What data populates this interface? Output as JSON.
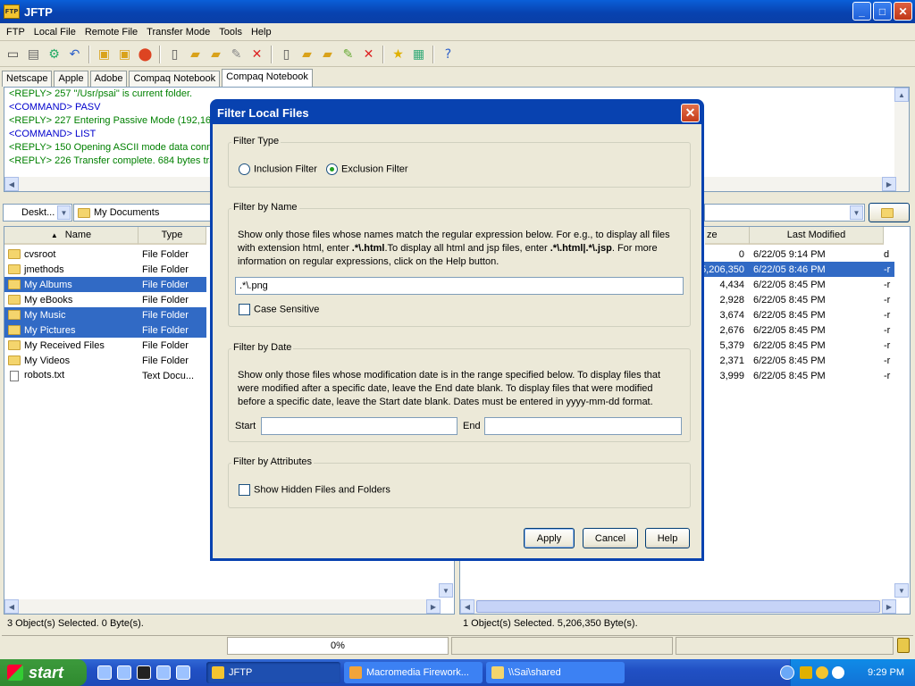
{
  "window": {
    "title": "JFTP",
    "icon_label": "FTP",
    "minimize": "_",
    "maximize": "□",
    "close": "✕"
  },
  "menu": [
    "FTP",
    "Local File",
    "Remote File",
    "Transfer Mode",
    "Tools",
    "Help"
  ],
  "tabs": [
    "Netscape",
    "Apple",
    "Adobe",
    "Compaq Notebook",
    "Compaq Notebook"
  ],
  "log": [
    {
      "text": "<REPLY> 257 \"/Usr/psai\" is current folder.",
      "color": "#008000"
    },
    {
      "text": "<COMMAND> PASV",
      "color": "#0000cc"
    },
    {
      "text": "<REPLY> 227 Entering Passive Mode (192,168",
      "color": "#008000"
    },
    {
      "text": "<COMMAND> LIST",
      "color": "#0000cc"
    },
    {
      "text": "<REPLY> 150 Opening ASCII mode data conne",
      "color": "#008000"
    },
    {
      "text": "<REPLY> 226 Transfer complete. 684 bytes tra",
      "color": "#008000"
    }
  ],
  "local": {
    "drive": "Deskt...",
    "path": "My Documents",
    "columns": [
      "Name",
      "Type"
    ],
    "rows": [
      {
        "name": "cvsroot",
        "type": "File Folder",
        "selected": false,
        "icon": "folder"
      },
      {
        "name": "jmethods",
        "type": "File Folder",
        "selected": false,
        "icon": "folder"
      },
      {
        "name": "My Albums",
        "type": "File Folder",
        "selected": true,
        "icon": "folder"
      },
      {
        "name": "My eBooks",
        "type": "File Folder",
        "selected": false,
        "icon": "folder"
      },
      {
        "name": "My Music",
        "type": "File Folder",
        "selected": true,
        "icon": "folder"
      },
      {
        "name": "My Pictures",
        "type": "File Folder",
        "selected": true,
        "icon": "folder"
      },
      {
        "name": "My Received Files",
        "type": "File Folder",
        "selected": false,
        "icon": "folder"
      },
      {
        "name": "My Videos",
        "type": "File Folder",
        "selected": false,
        "icon": "folder"
      },
      {
        "name": "robots.txt",
        "type": "Text Docu...",
        "selected": false,
        "icon": "file"
      }
    ],
    "status": "3 Object(s) Selected. 0 Byte(s)."
  },
  "remote": {
    "columns": [
      "ze",
      "Last Modified"
    ],
    "rows": [
      {
        "size": "0",
        "modified": "6/22/05 9:14 PM",
        "attr": "d",
        "selected": false
      },
      {
        "size": "5,206,350",
        "modified": "6/22/05 8:46 PM",
        "attr": "-r",
        "selected": true
      },
      {
        "size": "4,434",
        "modified": "6/22/05 8:45 PM",
        "attr": "-r",
        "selected": false
      },
      {
        "size": "2,928",
        "modified": "6/22/05 8:45 PM",
        "attr": "-r",
        "selected": false
      },
      {
        "size": "3,674",
        "modified": "6/22/05 8:45 PM",
        "attr": "-r",
        "selected": false
      },
      {
        "size": "2,676",
        "modified": "6/22/05 8:45 PM",
        "attr": "-r",
        "selected": false
      },
      {
        "size": "5,379",
        "modified": "6/22/05 8:45 PM",
        "attr": "-r",
        "selected": false
      },
      {
        "size": "2,371",
        "modified": "6/22/05 8:45 PM",
        "attr": "-r",
        "selected": false
      },
      {
        "size": "3,999",
        "modified": "6/22/05 8:45 PM",
        "attr": "-r",
        "selected": false
      }
    ],
    "status": "1 Object(s) Selected. 5,206,350 Byte(s)."
  },
  "progress": {
    "text": "0%",
    "value": 0
  },
  "dialog": {
    "title": "Filter Local Files",
    "filter_type": {
      "label": "Filter Type",
      "inclusion": "Inclusion Filter",
      "exclusion": "Exclusion Filter",
      "selected": "exclusion"
    },
    "by_name": {
      "label": "Filter by Name",
      "desc1": "Show only those files whose names match the regular expression below. For e.g., to display all files",
      "desc2a": "with extension html, enter ",
      "desc2b": ".*\\.html",
      "desc2c": ".To display all html and jsp files, enter ",
      "desc2d": ".*\\.html|.*\\.jsp",
      "desc2e": ". For more",
      "desc3": "information on regular expressions, click on the Help button.",
      "value": ".*\\.png",
      "case_label": "Case Sensitive",
      "case_checked": false
    },
    "by_date": {
      "label": "Filter by Date",
      "desc1": "Show only those files whose modification date is in the range specified below. To display files that",
      "desc2": "were modified after a specific date, leave the End date blank. To display files that were modified",
      "desc3": "before a specific date, leave the Start date blank. Dates must be entered in yyyy-mm-dd format.",
      "start_label": "Start",
      "end_label": "End",
      "start_value": "",
      "end_value": ""
    },
    "by_attr": {
      "label": "Filter by Attributes",
      "hidden_label": "Show Hidden Files and Folders",
      "hidden_checked": false
    },
    "buttons": {
      "apply": "Apply",
      "cancel": "Cancel",
      "help": "Help"
    }
  },
  "taskbar": {
    "start": "start",
    "tasks": [
      {
        "label": "JFTP",
        "active": true
      },
      {
        "label": "Macromedia Firework...",
        "active": false
      },
      {
        "label": "\\\\Sai\\shared",
        "active": false
      }
    ],
    "clock": "9:29 PM"
  }
}
